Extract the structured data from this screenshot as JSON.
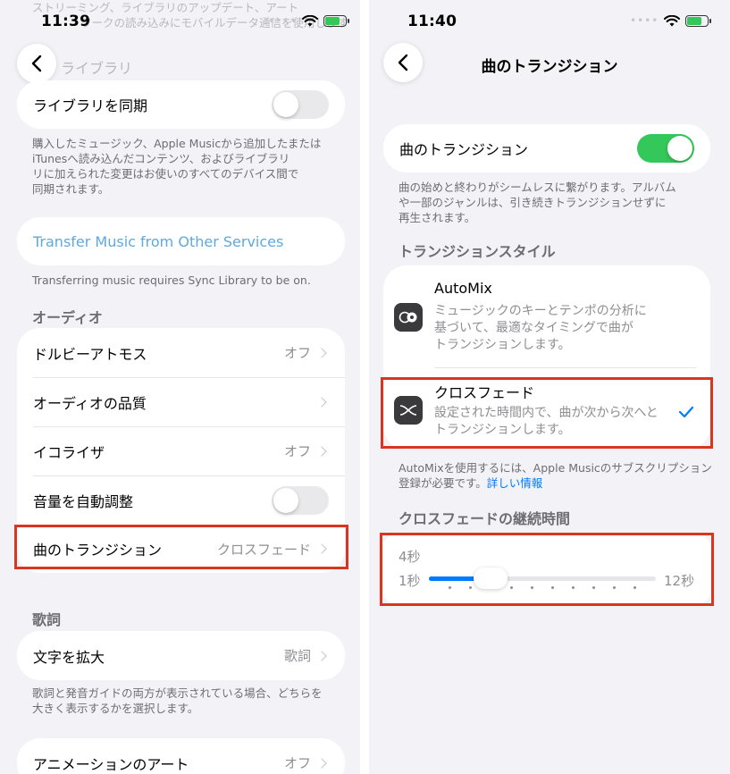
{
  "left": {
    "status_time": "11:39",
    "top_faded_text_1": "ストリーミング、ライブラリのアップデート、アート",
    "top_faded_text_2": "ワークの読み込みにモバイルデータ通信を使用します",
    "library_header": "ライブラリ",
    "sync_library_label": "ライブラリを同期",
    "sync_library_on": false,
    "sync_footnote": [
      "購入したミュージック、Apple Musicから追加したまたは",
      "iTunesへ読み込んだコンテンツ、およびライブラリ",
      "リに加えられた変更はお使いのすべてのデバイス間で",
      "同期されます。"
    ],
    "transfer_label": "Transfer Music from Other Services",
    "transfer_footnote": "Transferring music requires Sync Library to be on.",
    "audio_header": "オーディオ",
    "audio_rows": [
      {
        "label": "ドルビーアトモス",
        "value": "オフ"
      },
      {
        "label": "オーディオの品質",
        "value": ""
      },
      {
        "label": "イコライザ",
        "value": "オフ"
      },
      {
        "label": "音量を自動調整",
        "value": ""
      },
      {
        "label": "曲のトランジション",
        "value": "クロスフェード"
      }
    ],
    "auto_volume_on": false,
    "lyrics_header": "歌詞",
    "lyrics_row": {
      "label": "文字を拡大",
      "value": "歌詞"
    },
    "lyrics_footnote": [
      "歌詞と発音ガイドの両方が表示されている場合、どちらを",
      "大きく表示するかを選択します。"
    ],
    "animation_row": {
      "label": "アニメーションのアート",
      "value": "オフ"
    }
  },
  "right": {
    "status_time": "11:40",
    "nav_title": "曲のトランジション",
    "transition_toggle_label": "曲のトランジション",
    "transition_on": true,
    "transition_footnote": [
      "曲の始めと終わりがシームレスに繋がります。アルバム",
      "や一部のジャンルは、引き続きトランジションせずに",
      "再生されます。"
    ],
    "style_header": "トランジションスタイル",
    "automix_title": "AutoMix",
    "automix_desc": [
      "ミュージックのキーとテンポの分析に",
      "基づいて、最適なタイミングで曲が",
      "トランジションします。"
    ],
    "crossfade_title": "クロスフェード",
    "crossfade_desc": [
      "設定された時間内で、曲が次から次へと",
      "トランジションします。"
    ],
    "crossfade_selected": true,
    "automix_note": "AutoMixを使用するには、Apple Musicのサブスクリプション",
    "automix_note_2": "登録が必要です。",
    "automix_link": "詳しい情報",
    "duration_header": "クロスフェードの継続時間",
    "duration_current": "4秒",
    "duration_min_label": "1秒",
    "duration_max_label": "12秒",
    "duration_value": 4,
    "duration_min": 1,
    "duration_max": 12
  },
  "colors": {
    "accent": "#007aff",
    "toggle_on": "#34c759",
    "highlight": "#d9351f"
  },
  "icons": {
    "back": "chevron-left-icon",
    "wifi": "wifi-icon",
    "battery": "battery-charging-icon",
    "automix": "automix-icon",
    "crossfade": "crossfade-icon",
    "check": "checkmark-icon"
  }
}
